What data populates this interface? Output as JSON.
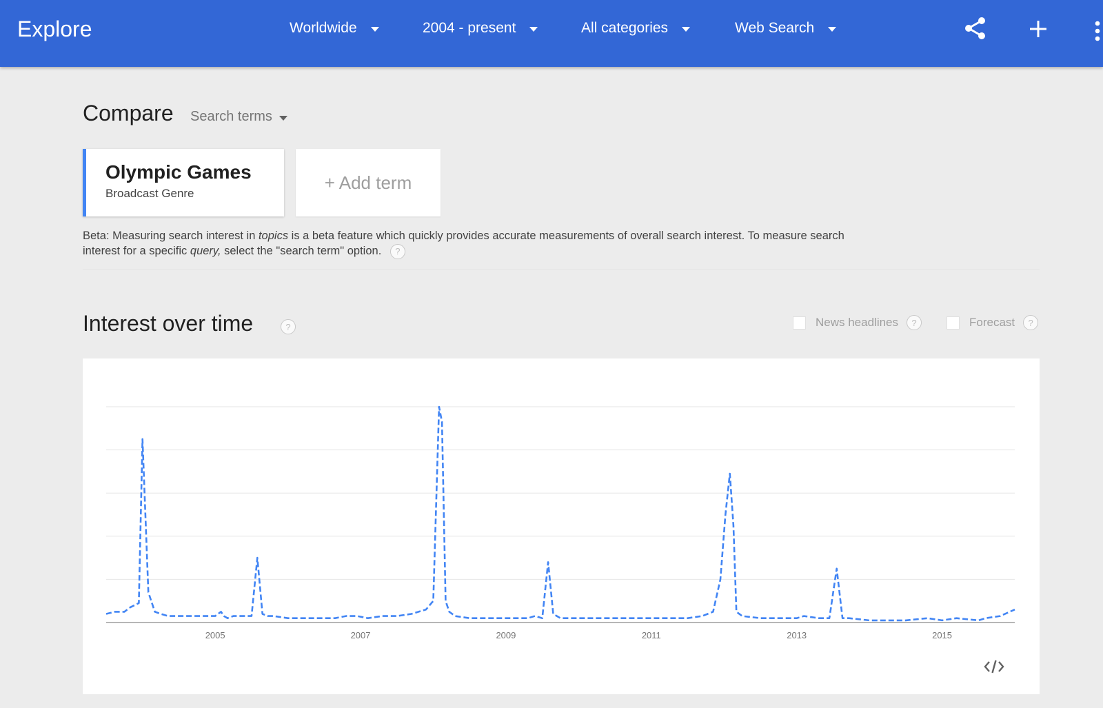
{
  "header": {
    "title": "Explore",
    "filters": [
      {
        "label": "Worldwide"
      },
      {
        "label": "2004 - present"
      },
      {
        "label": "All categories"
      },
      {
        "label": "Web Search"
      }
    ]
  },
  "compare": {
    "heading": "Compare",
    "mode_label": "Search terms",
    "term": {
      "name": "Olympic Games",
      "type": "Broadcast Genre"
    },
    "add_term_label": "+ Add term",
    "beta_note": {
      "part1": "Beta: Measuring search interest in ",
      "topics": "topics",
      "part2": " is a beta feature which quickly provides accurate measurements of overall search interest. To measure search interest for a specific ",
      "query": "query,",
      "part3": " select the \"search term\" option."
    }
  },
  "interest": {
    "heading": "Interest over time",
    "news_headlines_label": "News headlines",
    "forecast_label": "Forecast",
    "help_glyph": "?"
  },
  "colors": {
    "brand": "#3367d6",
    "series": "#4285f4"
  },
  "chart_data": {
    "type": "line",
    "series_style": "dashed",
    "x_tick_labels": [
      "2005",
      "2007",
      "2009",
      "2011",
      "2013",
      "2015"
    ],
    "x_range": [
      2004.0,
      2016.5
    ],
    "ylim": [
      0,
      100
    ],
    "grid": true,
    "x": [
      2004.0,
      2004.12,
      2004.25,
      2004.33,
      2004.45,
      2004.5,
      2004.58,
      2004.67,
      2004.75,
      2004.85,
      2005.0,
      2005.25,
      2005.4,
      2005.5,
      2005.58,
      2005.62,
      2005.67,
      2005.75,
      2005.95,
      2006.0,
      2006.08,
      2006.15,
      2006.22,
      2006.3,
      2006.5,
      2007.0,
      2007.15,
      2007.3,
      2007.45,
      2007.6,
      2007.8,
      2008.0,
      2008.2,
      2008.4,
      2008.5,
      2008.58,
      2008.62,
      2008.67,
      2008.72,
      2008.8,
      2009.0,
      2009.2,
      2009.5,
      2009.8,
      2009.9,
      2010.0,
      2010.08,
      2010.15,
      2010.25,
      2010.5,
      2011.0,
      2011.5,
      2012.0,
      2012.2,
      2012.35,
      2012.45,
      2012.52,
      2012.58,
      2012.63,
      2012.67,
      2012.75,
      2013.0,
      2013.3,
      2013.5,
      2013.6,
      2013.8,
      2013.95,
      2014.05,
      2014.13,
      2014.22,
      2014.5,
      2014.6,
      2015.0,
      2015.3,
      2015.5,
      2015.7,
      2016.0,
      2016.1,
      2016.3,
      2016.5
    ],
    "values": [
      4,
      5,
      5,
      7,
      9,
      85,
      14,
      5,
      4,
      3,
      3,
      3,
      3,
      3,
      5,
      3,
      2,
      3,
      3,
      3,
      30,
      4,
      3,
      3,
      2,
      2,
      2,
      3,
      3,
      2,
      3,
      3,
      4,
      6,
      10,
      100,
      93,
      10,
      5,
      3,
      2,
      2,
      2,
      2,
      3,
      2,
      28,
      4,
      2,
      2,
      2,
      2,
      2,
      3,
      5,
      20,
      50,
      69,
      45,
      5,
      3,
      2,
      2,
      2,
      3,
      2,
      2,
      25,
      2,
      2,
      1,
      1,
      1,
      2,
      1,
      2,
      1,
      2,
      3,
      6
    ]
  }
}
